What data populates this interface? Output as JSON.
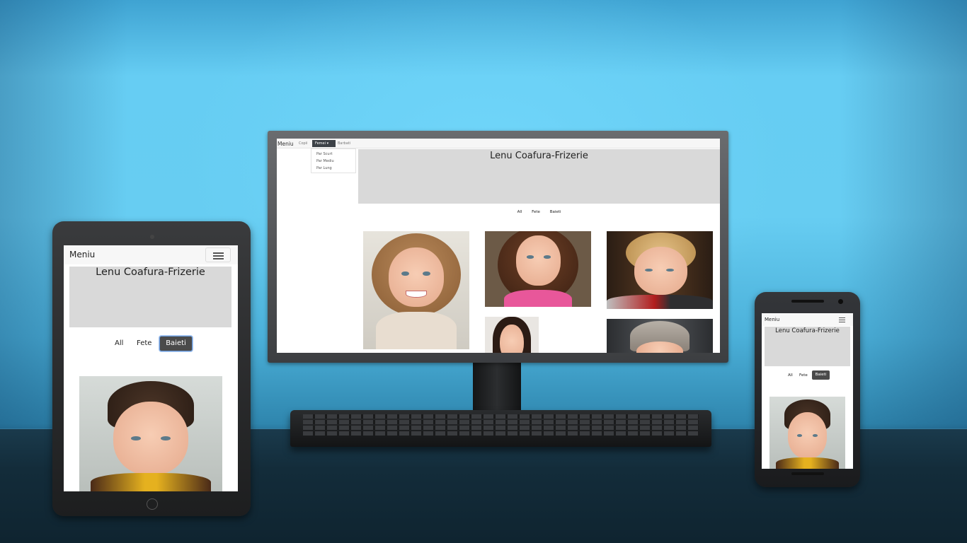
{
  "site": {
    "brand": "Meniu",
    "title": "Lenu Coafura-Frizerie",
    "filters": [
      "All",
      "Fete",
      "Baieti"
    ],
    "active_filter": "Baieti"
  },
  "desktop": {
    "nav": {
      "copii": "Copii",
      "femei": "Femei",
      "barbati": "Barbati"
    },
    "dropdown": [
      "Par Scurt",
      "Par Mediu",
      "Par Lung"
    ]
  },
  "colors": {
    "wall": "#67cdf2",
    "desk": "#132c3a",
    "header_bg": "#d9d9d9",
    "active_btn": "#4a4a4a"
  },
  "icons": {
    "menu_toggle": "hamburger-icon",
    "dropdown_caret": "caret-down-icon"
  }
}
